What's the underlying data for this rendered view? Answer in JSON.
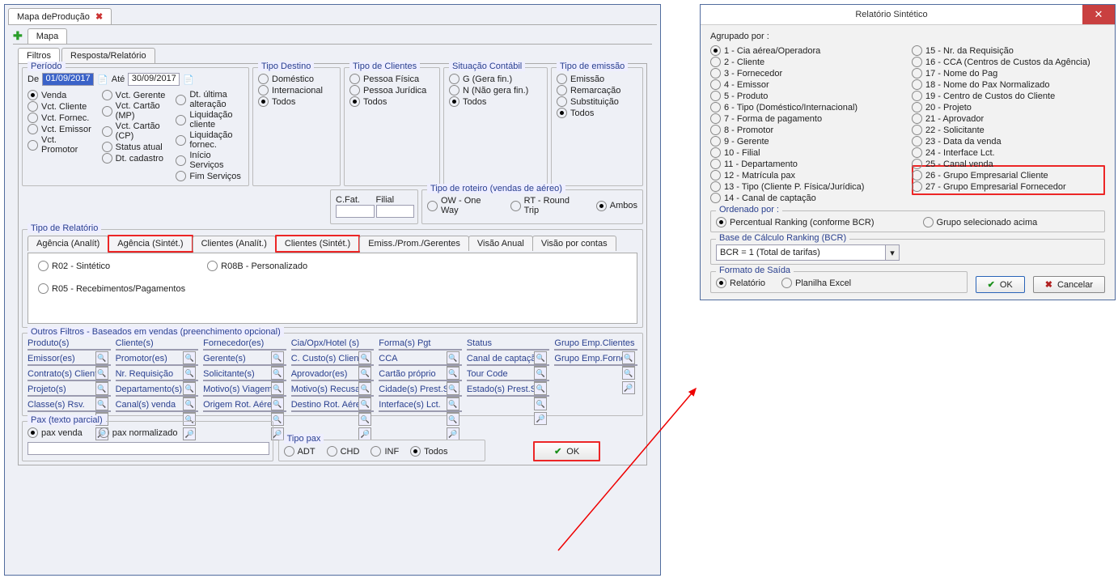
{
  "leftWindow": {
    "titleTab": "Mapa deProdução",
    "subTab": "Mapa",
    "viewTabs": {
      "filtros": "Filtros",
      "resposta": "Resposta/Relatório"
    },
    "periodo": {
      "legend": "Período",
      "de": "De",
      "deVal": "01/09/2017",
      "ate": "Até",
      "ateVal": "30/09/2017",
      "col1": [
        "Venda",
        "Vct. Cliente",
        "Vct. Fornec.",
        "Vct. Emissor",
        "Vct. Promotor"
      ],
      "col2": [
        "Vct. Gerente",
        "Vct. Cartão (MP)",
        "Vct. Cartão (CP)",
        "Status atual",
        "Dt. cadastro"
      ],
      "col3": [
        "Dt. última alteração",
        "Liquidação cliente",
        "Liquidação fornec.",
        "Início Serviços",
        "Fim Serviços"
      ]
    },
    "tipoDestino": {
      "legend": "Tipo Destino",
      "opts": [
        "Doméstico",
        "Internacional",
        "Todos"
      ]
    },
    "tipoCliente": {
      "legend": "Tipo de Clientes",
      "opts": [
        "Pessoa Física",
        "Pessoa Jurídica",
        "Todos"
      ]
    },
    "sitCont": {
      "legend": "Situação Contábil",
      "opts": [
        "G (Gera fin.)",
        "N (Não gera fin.)",
        "Todos"
      ]
    },
    "tipoEmissao": {
      "legend": "Tipo de emissão",
      "opts": [
        "Emissão",
        "Remarcação",
        "Substituição",
        "Todos"
      ]
    },
    "cfat": {
      "cfat": "C.Fat.",
      "filial": "Filial"
    },
    "roteiro": {
      "legend": "Tipo de roteiro (vendas de aéreo)",
      "opts": [
        "OW - One Way",
        "RT - Round Trip",
        "Ambos"
      ]
    },
    "tipoRel": {
      "legend": "Tipo de Relatório",
      "tabs": [
        "Agência (Analít)",
        "Agência (Sintét.)",
        "Clientes (Analít.)",
        "Clientes (Sintét.)",
        "Emiss./Prom./Gerentes",
        "Visão Anual",
        "Visão por contas"
      ],
      "r02": "R02 - Sintético",
      "r08b": "R08B - Personalizado",
      "r05": "R05 - Recebimentos/Pagamentos"
    },
    "outrosLegend": "Outros Filtros - Baseados em vendas (preenchimento opcional)",
    "of": [
      [
        "Produto(s)",
        "Cliente(s)",
        "Fornecedor(es)",
        "Cia/Opx/Hotel (s)",
        "Forma(s) Pgt",
        "Status",
        "Grupo Emp.Clientes"
      ],
      [
        "Emissor(es)",
        "Promotor(es)",
        "Gerente(s)",
        "C. Custo(s) Cliente",
        "CCA",
        "Canal de captação",
        "Grupo Emp.Fornec."
      ],
      [
        "Contrato(s) Cliente",
        "Nr. Requisição",
        "Solicitante(s)",
        "Aprovador(es)",
        "Cartão próprio",
        "Tour Code",
        ""
      ],
      [
        "Projeto(s)",
        "Departamento(s)",
        "Motivo(s) Viagem",
        "Motivo(s) Recusa",
        "Cidade(s) Prest.Svc.",
        "Estado(s) Prest.Svc.",
        ""
      ],
      [
        "Classe(s) Rsv.",
        "Canal(s) venda",
        "Origem Rot. Aéreo",
        "Destino Rot. Aéreo",
        "Interface(s) Lct.",
        "",
        ""
      ]
    ],
    "pax": {
      "legend": "Pax (texto parcial)",
      "venda": "pax venda",
      "norm": "pax normalizado"
    },
    "tipopax": {
      "legend": "Tipo pax",
      "opts": [
        "ADT",
        "CHD",
        "INF",
        "Todos"
      ]
    },
    "okBtn": "OK"
  },
  "dialog": {
    "title": "Relatório Sintético",
    "agrupado": "Agrupado por :",
    "left": [
      "1 - Cia aérea/Operadora",
      "2 - Cliente",
      "3 - Fornecedor",
      "4 - Emissor",
      "5 - Produto",
      "6 - Tipo (Doméstico/Internacional)",
      "7 - Forma de pagamento",
      "8 - Promotor",
      "9 - Gerente",
      "10 - Filial",
      "11 - Departamento",
      "12 - Matrícula pax",
      "13 - Tipo (Cliente P. Física/Jurídica)",
      "14 - Canal de captação"
    ],
    "right": [
      "15 - Nr. da Requisição",
      "16 - CCA (Centros de Custos da Agência)",
      "17 - Nome do Pag",
      "18 - Nome do Pax Normalizado",
      "19 - Centro de Custos do Cliente",
      "20 - Projeto",
      "21 - Aprovador",
      "22 - Solicitante",
      "23 - Data da venda",
      "24 - Interface Lct.",
      "25 - Canal venda",
      "26 - Grupo Empresarial Cliente",
      "27 - Grupo Empresarial Fornecedor"
    ],
    "ordenado": {
      "legend": "Ordenado por :",
      "percentual": "Percentual Ranking (conforme BCR)",
      "grupo": "Grupo selecionado acima"
    },
    "bcr": {
      "legend": "Base de Cálculo Ranking (BCR)",
      "val": "BCR = 1 (Total de tarifas)"
    },
    "formato": {
      "legend": "Formato de Saída",
      "rel": "Relatório",
      "plan": "Planilha Excel"
    },
    "ok": "OK",
    "cancel": "Cancelar"
  }
}
